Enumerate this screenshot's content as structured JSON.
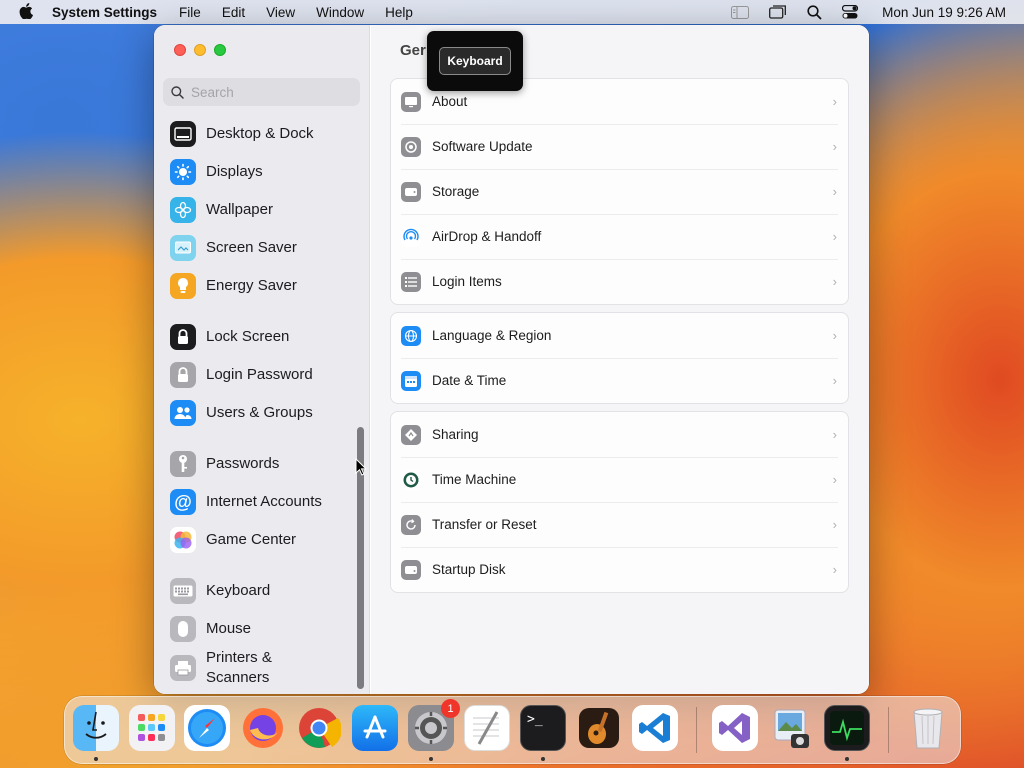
{
  "menubar": {
    "app_name": "System Settings",
    "menus": [
      "File",
      "Edit",
      "View",
      "Window",
      "Help"
    ],
    "clock": "Mon Jun 19  9:26 AM"
  },
  "window": {
    "title": "General",
    "title_visible": "Ger",
    "search_placeholder": "Search"
  },
  "sidebar": {
    "items": [
      {
        "label": "Desktop & Dock",
        "icon": "desktop-dock-icon",
        "color": "#1c1c1e"
      },
      {
        "label": "Displays",
        "icon": "displays-icon",
        "color": "#1e8cf5"
      },
      {
        "label": "Wallpaper",
        "icon": "wallpaper-icon",
        "color": "#36b3e8"
      },
      {
        "label": "Screen Saver",
        "icon": "screen-saver-icon",
        "color": "#5ac8e6"
      },
      {
        "label": "Energy Saver",
        "icon": "energy-saver-icon",
        "color": "#f5a623"
      },
      {
        "label": "Lock Screen",
        "icon": "lock-screen-icon",
        "color": "#1c1c1e"
      },
      {
        "label": "Login Password",
        "icon": "login-password-icon",
        "color": "#8e8e93"
      },
      {
        "label": "Users & Groups",
        "icon": "users-groups-icon",
        "color": "#1e8cf5"
      },
      {
        "label": "Passwords",
        "icon": "passwords-icon",
        "color": "#8e8e93"
      },
      {
        "label": "Internet Accounts",
        "icon": "internet-accounts-icon",
        "color": "#1e8cf5"
      },
      {
        "label": "Game Center",
        "icon": "game-center-icon",
        "color": "#ffffff"
      },
      {
        "label": "Keyboard",
        "icon": "keyboard-icon",
        "color": "#8e8e93"
      },
      {
        "label": "Mouse",
        "icon": "mouse-icon",
        "color": "#8e8e93"
      },
      {
        "label": "Printers & Scanners",
        "icon": "printers-scanners-icon",
        "color": "#8e8e93"
      }
    ]
  },
  "general": {
    "groups": [
      {
        "rows": [
          {
            "label": "About",
            "icon": "about-icon"
          },
          {
            "label": "Software Update",
            "icon": "software-update-icon"
          },
          {
            "label": "Storage",
            "icon": "storage-icon"
          },
          {
            "label": "AirDrop & Handoff",
            "icon": "airdrop-icon"
          },
          {
            "label": "Login Items",
            "icon": "login-items-icon"
          }
        ]
      },
      {
        "rows": [
          {
            "label": "Language & Region",
            "icon": "globe-icon"
          },
          {
            "label": "Date & Time",
            "icon": "calendar-icon"
          }
        ]
      },
      {
        "rows": [
          {
            "label": "Sharing",
            "icon": "sharing-icon"
          },
          {
            "label": "Time Machine",
            "icon": "time-machine-icon"
          },
          {
            "label": "Transfer or Reset",
            "icon": "transfer-reset-icon"
          },
          {
            "label": "Startup Disk",
            "icon": "startup-disk-icon"
          }
        ]
      }
    ]
  },
  "tooltip": {
    "text": "Keyboard"
  },
  "dock": {
    "settings_badge": "1",
    "apps": [
      "Finder",
      "Launchpad",
      "Safari",
      "Firefox",
      "Chrome",
      "App Store",
      "System Settings",
      "TextEdit",
      "Terminal",
      "GarageBand",
      "Visual Studio Code",
      "Visual Studio",
      "Preview",
      "Activity Monitor",
      "Trash"
    ]
  }
}
